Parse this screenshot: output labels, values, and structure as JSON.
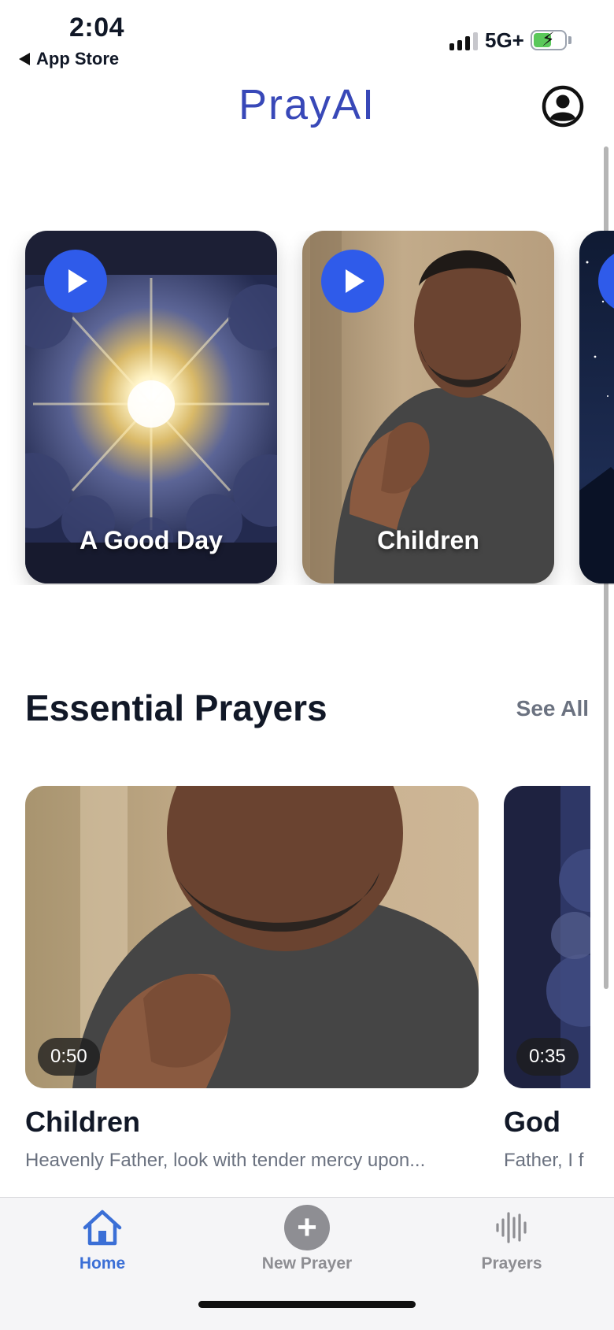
{
  "status_bar": {
    "time": "2:04",
    "back_label": "App Store",
    "network": "5G+"
  },
  "header": {
    "logo": "PrayAI",
    "profile_icon": "person-circle-icon"
  },
  "featured": [
    {
      "label": "A Good Day",
      "play_icon": "play-icon",
      "art": "sun-through-clouds"
    },
    {
      "label": "Children",
      "play_icon": "play-icon",
      "art": "man-praying"
    },
    {
      "label": "",
      "play_icon": "play-icon",
      "art": "night-sky"
    }
  ],
  "essential_section": {
    "title": "Essential Prayers",
    "see_all": "See All",
    "items": [
      {
        "duration": "0:50",
        "title": "Children",
        "excerpt": "Heavenly Father, look with tender mercy upon..."
      },
      {
        "duration": "0:35",
        "title": "God",
        "excerpt": "Father, I f"
      }
    ]
  },
  "tab_bar": {
    "tabs": [
      {
        "label": "Home",
        "icon": "home-icon",
        "active": true
      },
      {
        "label": "New Prayer",
        "icon": "plus-circle-icon",
        "active": false
      },
      {
        "label": "Prayers",
        "icon": "waveform-icon",
        "active": false
      }
    ]
  },
  "colors": {
    "accent": "#2f5bea",
    "logo": "#3848b8",
    "tab_active": "#3b6fd6",
    "muted": "#6b7280"
  }
}
